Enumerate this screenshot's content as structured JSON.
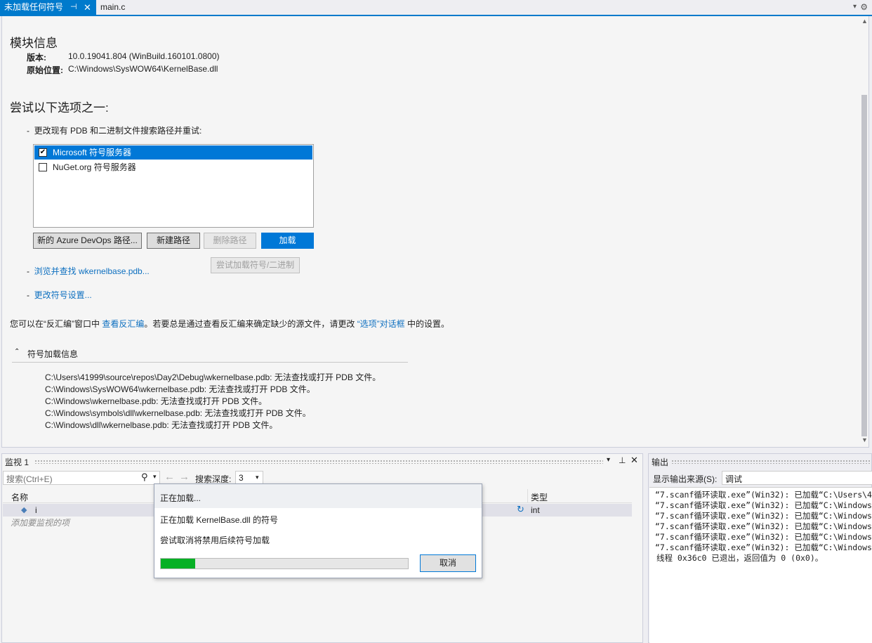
{
  "tabs": [
    {
      "label": "未加载任何符号",
      "active": true
    },
    {
      "label": "main.c",
      "active": false
    }
  ],
  "module_info": {
    "title": "模块信息",
    "version_label": "版本:",
    "version_value": "10.0.19041.804 (WinBuild.160101.0800)",
    "location_label": "原始位置:",
    "location_value": "C:\\Windows\\SysWOW64\\KernelBase.dll"
  },
  "options": {
    "title": "尝试以下选项之一:",
    "bullet1": "更改现有 PDB 和二进制文件搜索路径并重试:",
    "list_items": [
      {
        "label": "Microsoft 符号服务器",
        "checked": true,
        "selected": true
      },
      {
        "label": "NuGet.org 符号服务器",
        "checked": false,
        "selected": false
      }
    ],
    "buttons": {
      "azure": "新的 Azure DevOps 路径...",
      "new_path": "新建路径",
      "delete_path": "删除路径",
      "load": "加载",
      "try_load": "尝试加载符号/二进制"
    },
    "browse_link": "浏览并查找 wkernelbase.pdb...",
    "settings_link": "更改符号设置..."
  },
  "disasm_note": {
    "prefix": "您可以在“反汇编”窗口中 ",
    "link1": "查看反汇编",
    "middle": "。若要总是通过查看反汇编来确定缺少的源文件，请更改 ",
    "link2": "“选项”对话框",
    "suffix": " 中的设置。"
  },
  "symbol_load": {
    "header": "符号加载信息",
    "lines": [
      "C:\\Users\\41999\\source\\repos\\Day2\\Debug\\wkernelbase.pdb: 无法查找或打开 PDB 文件。",
      "C:\\Windows\\SysWOW64\\wkernelbase.pdb: 无法查找或打开 PDB 文件。",
      "C:\\Windows\\wkernelbase.pdb: 无法查找或打开 PDB 文件。",
      "C:\\Windows\\symbols\\dll\\wkernelbase.pdb: 无法查找或打开 PDB 文件。",
      "C:\\Windows\\dll\\wkernelbase.pdb: 无法查找或打开 PDB 文件。"
    ]
  },
  "watch": {
    "title": "监视 1",
    "search_placeholder": "搜索(Ctrl+E)",
    "depth_label": "搜索深度:",
    "depth_value": "3",
    "col_name": "名称",
    "col_type": "类型",
    "row_name": "i",
    "row_type": "int",
    "add_hint": "添加要监视的项"
  },
  "dialog": {
    "title": "正在加载...",
    "line1": "正在加载 KernelBase.dll 的符号",
    "line2": "尝试取消将禁用后续符号加载",
    "progress": 0.14,
    "cancel": "取消"
  },
  "output": {
    "title": "输出",
    "source_label": "显示输出来源(S):",
    "source_value": "调试",
    "lines": [
      "“7.scanf循环读取.exe”(Win32): 已加载“C:\\Users\\41",
      "“7.scanf循环读取.exe”(Win32): 已加载“C:\\Windows\\",
      "“7.scanf循环读取.exe”(Win32): 已加载“C:\\Windows\\",
      "“7.scanf循环读取.exe”(Win32): 已加载“C:\\Windows\\",
      "“7.scanf循环读取.exe”(Win32): 已加载“C:\\Windows\\",
      "“7.scanf循环读取.exe”(Win32): 已加载“C:\\Windows\\",
      "线程 0x36c0 已退出，返回值为 0 (0x0)。"
    ]
  },
  "colors": {
    "accent": "#007acc",
    "progress": "#06b025",
    "link": "#0e70c0"
  }
}
